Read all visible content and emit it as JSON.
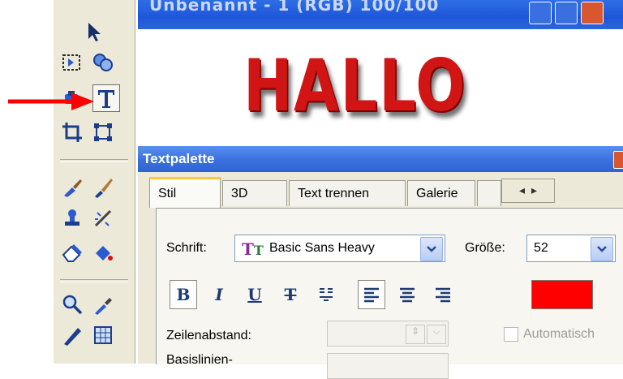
{
  "document": {
    "title": "Unbenannt - 1 (RGB) 100/100",
    "canvas_text": "HALLO"
  },
  "toolbar": {
    "tools": [
      {
        "name": "select-arrow-icon"
      },
      {
        "name": "selection-icon"
      },
      {
        "name": "shape-icon"
      },
      {
        "name": "paint-bucket-icon"
      },
      {
        "name": "text-icon",
        "selected": true
      },
      {
        "name": "crop-icon"
      },
      {
        "name": "transform-icon"
      },
      {
        "name": "brush-icon"
      },
      {
        "name": "paintbrush-icon"
      },
      {
        "name": "stamp-icon"
      },
      {
        "name": "effect-brush-icon"
      },
      {
        "name": "eraser-icon"
      },
      {
        "name": "fill-icon"
      },
      {
        "name": "zoom-icon"
      },
      {
        "name": "eyedropper-icon"
      },
      {
        "name": "pen-icon"
      },
      {
        "name": "grid-icon"
      }
    ]
  },
  "palette": {
    "title": "Textpalette",
    "tabs": [
      "Stil",
      "3D",
      "Text trennen",
      "Galerie"
    ],
    "active_tab": "Stil",
    "font_label": "Schrift:",
    "font_value": "Basic Sans Heavy",
    "size_label": "Größe:",
    "size_value": "52",
    "bold_glyph": "B",
    "italic_glyph": "I",
    "underline_glyph": "U",
    "strike_glyph": "T",
    "color_value": "#ff0000",
    "line_spacing_label": "Zeilenabstand:",
    "auto_label": "Automatisch",
    "baseline_label": "Basislinien-"
  },
  "colors": {
    "accent": "#ff0000",
    "title_bar": "#2a62d8",
    "tab_highlight": "#ffc83c"
  }
}
